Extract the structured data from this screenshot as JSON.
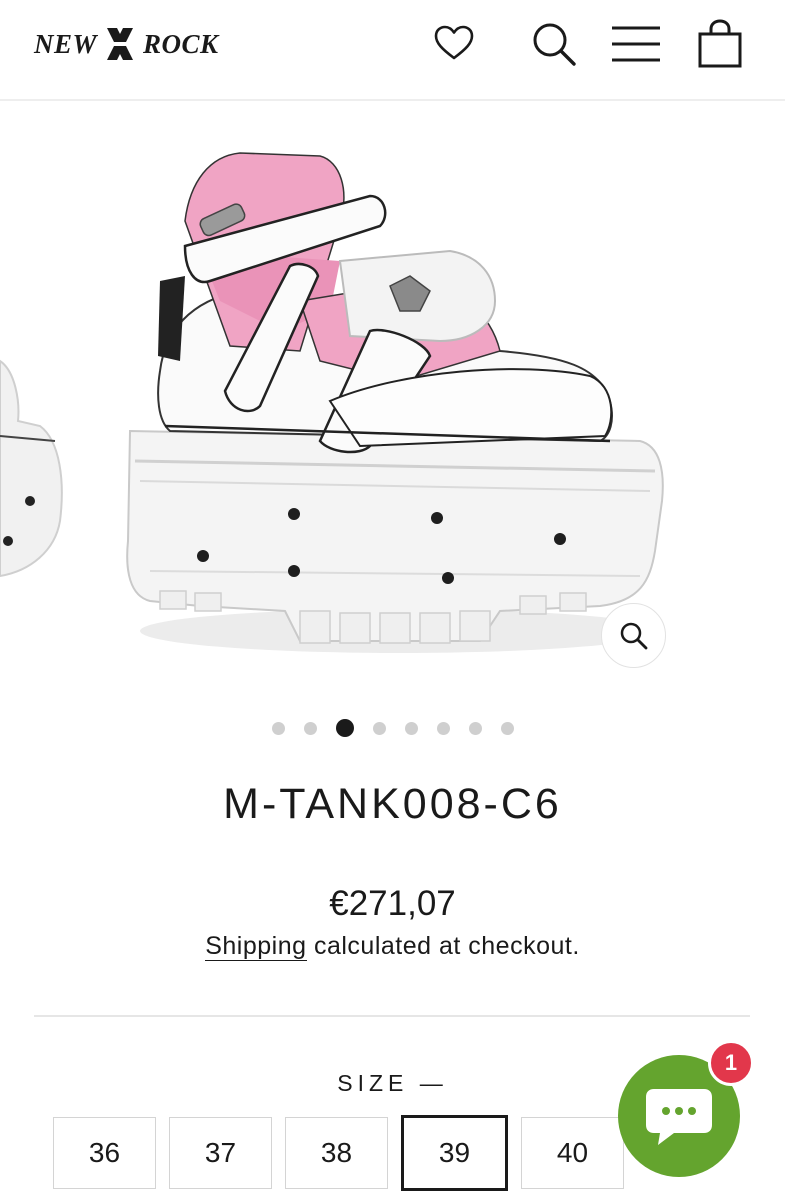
{
  "header": {
    "logo_left": "NEW",
    "logo_right": "ROCK",
    "icons": [
      "heart-icon",
      "search-icon",
      "menu-icon",
      "bag-icon"
    ]
  },
  "gallery": {
    "dot_count": 8,
    "active_index": 2,
    "zoom_icon": "zoom-icon"
  },
  "product": {
    "title": "M-TANK008-C6",
    "price": "€271,07",
    "shipping_link": "Shipping",
    "shipping_rest": " calculated at checkout."
  },
  "size": {
    "label": "SIZE —",
    "options": [
      "36",
      "37",
      "38",
      "39",
      "40"
    ],
    "selected": "39"
  },
  "chat": {
    "badge": "1",
    "icon": "chat-bubble-icon",
    "color": "#64a42e",
    "badge_color": "#e2374b"
  }
}
